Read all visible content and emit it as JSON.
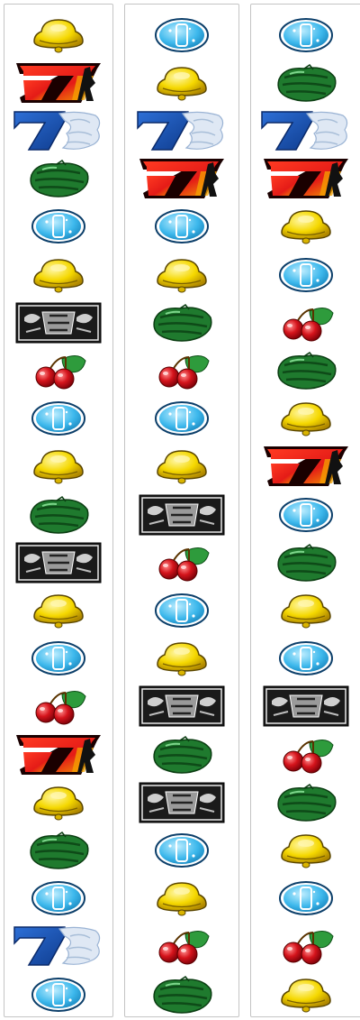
{
  "symbol_set": {
    "bell": "yellow-bell-icon",
    "replay": "blue-replay-icon",
    "red7": "red-seven-icon",
    "blue7": "blue-seven-icon",
    "watermelon": "watermelon-icon",
    "cherry": "cherry-icon",
    "bar": "bar-icon"
  },
  "reels": [
    {
      "name": "left-reel",
      "symbols": [
        "bell",
        "red7",
        "blue7",
        "watermelon",
        "replay",
        "bell",
        "bar",
        "cherry",
        "replay",
        "bell",
        "watermelon",
        "bar",
        "bell",
        "replay",
        "cherry",
        "red7",
        "bell",
        "watermelon",
        "replay",
        "blue7",
        "replay"
      ]
    },
    {
      "name": "center-reel",
      "symbols": [
        "replay",
        "bell",
        "blue7",
        "red7",
        "replay",
        "bell",
        "watermelon",
        "cherry",
        "replay",
        "bell",
        "bar",
        "cherry",
        "replay",
        "bell",
        "bar",
        "watermelon",
        "bar",
        "replay",
        "bell",
        "cherry",
        "watermelon"
      ]
    },
    {
      "name": "right-reel",
      "symbols": [
        "replay",
        "watermelon",
        "blue7",
        "red7",
        "bell",
        "replay",
        "cherry",
        "watermelon",
        "bell",
        "red7",
        "replay",
        "watermelon",
        "bell",
        "replay",
        "bar",
        "cherry",
        "watermelon",
        "bell",
        "replay",
        "cherry",
        "bell"
      ]
    }
  ],
  "colors": {
    "bell": "#f5d800",
    "replay": "#3db8ec",
    "red7": "#e41b17",
    "blue7": "#1a55b4",
    "watermelon": "#1f7a2e",
    "cherry": "#d5141c",
    "bar": "#1a1a1a"
  }
}
